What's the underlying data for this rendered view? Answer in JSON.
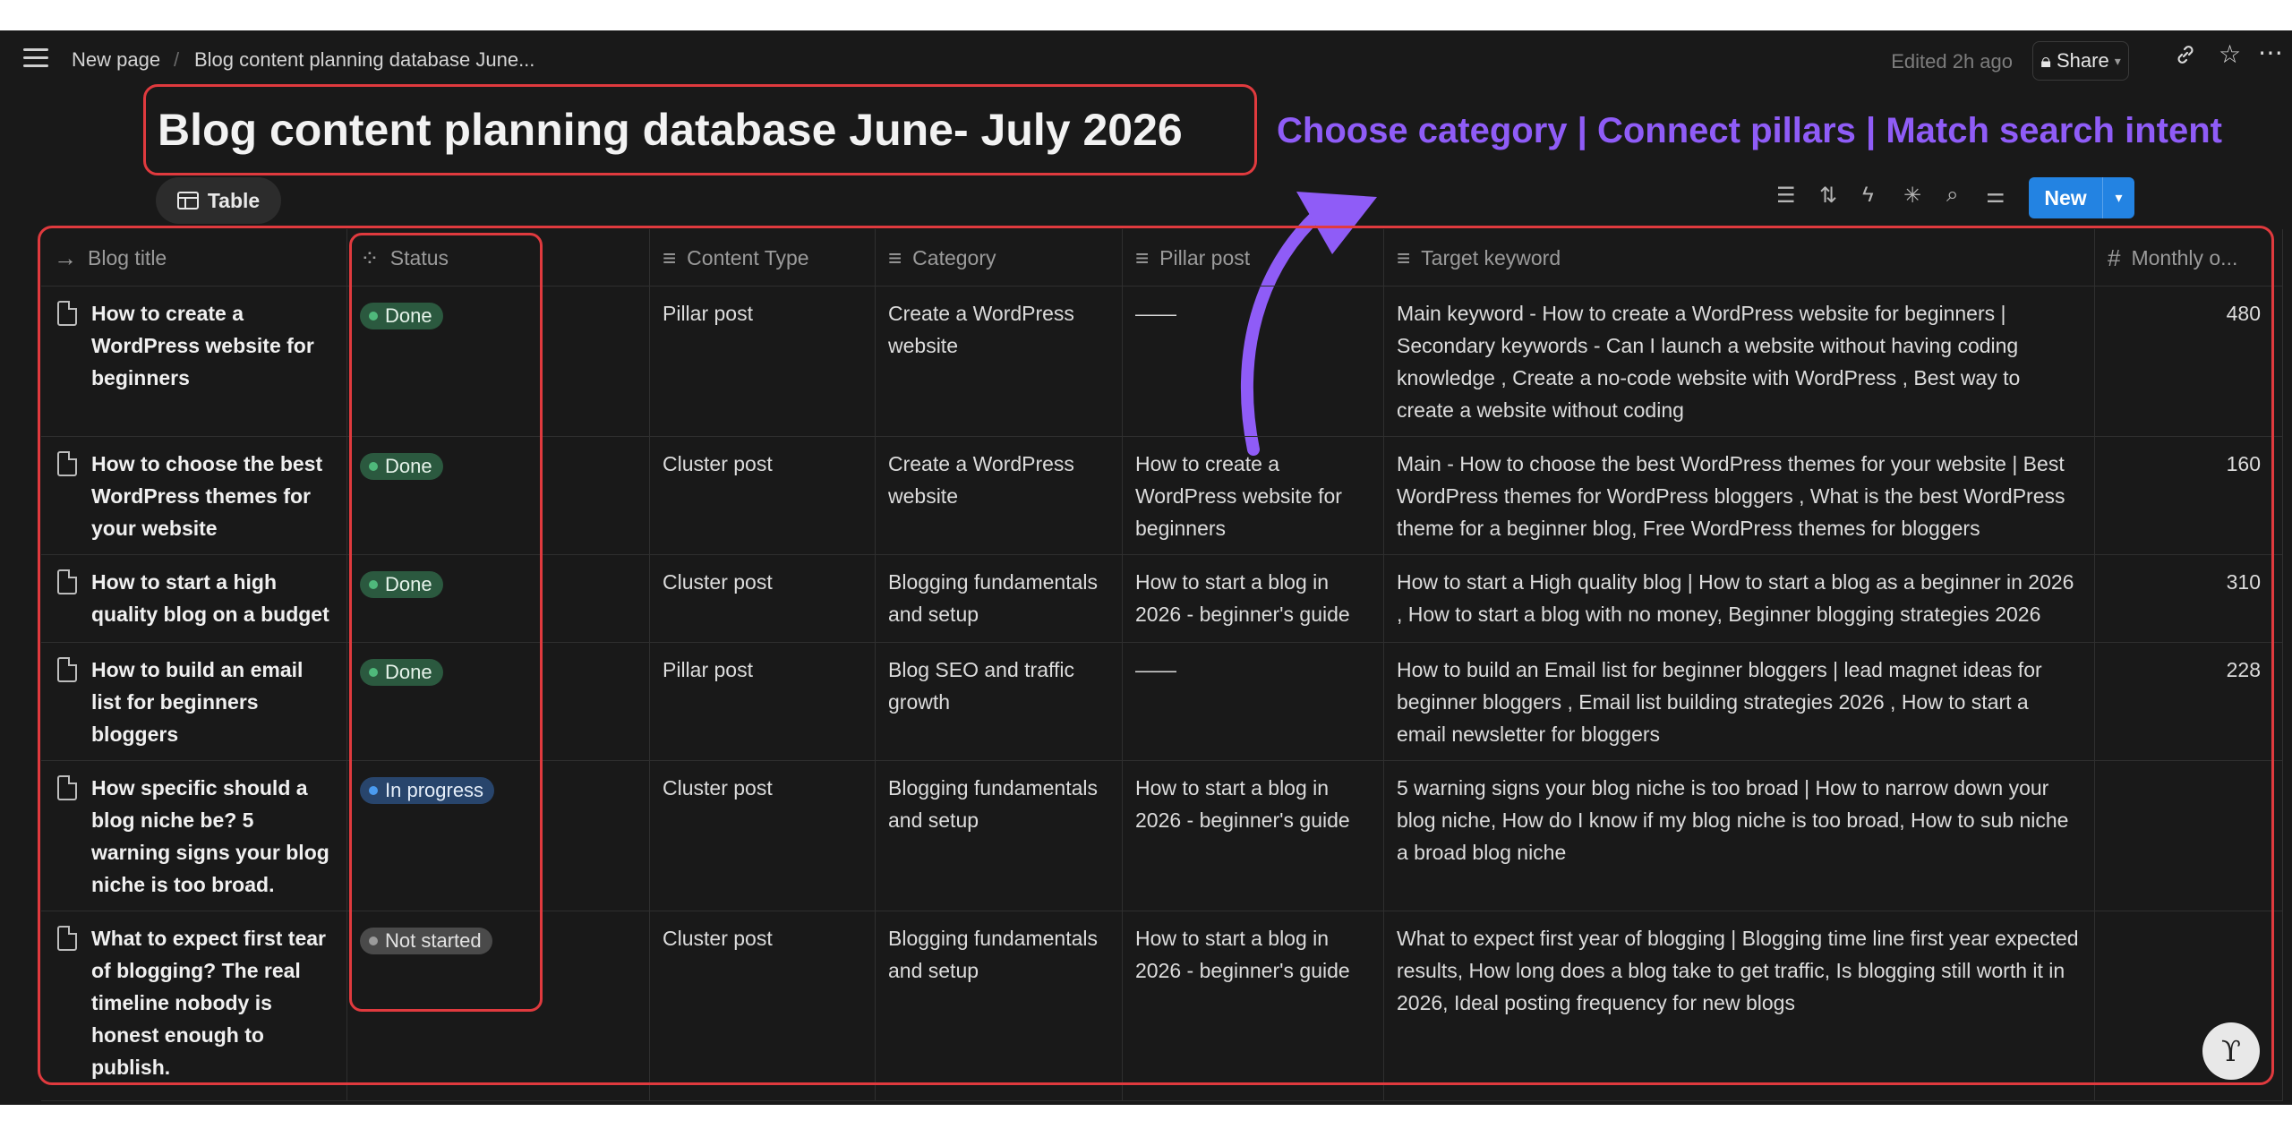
{
  "breadcrumb": {
    "items": [
      "New page",
      "Blog content planning database June..."
    ],
    "separator": "/"
  },
  "header": {
    "edited": "Edited 2h ago",
    "share_label": "Share"
  },
  "page": {
    "title": "Blog content planning database June- July 2026",
    "tagline": "Choose category | Connect pillars | Match search intent"
  },
  "view": {
    "tab_label": "Table"
  },
  "toolbar": {
    "new_label": "New"
  },
  "table": {
    "columns": [
      {
        "label": "Blog title",
        "icon": "arrow-right-icon"
      },
      {
        "label": "Status",
        "icon": "status-icon"
      },
      {
        "label": "Content Type",
        "icon": "text-lines-icon"
      },
      {
        "label": "Category",
        "icon": "text-lines-icon"
      },
      {
        "label": "Pillar post",
        "icon": "text-lines-icon"
      },
      {
        "label": "Target keyword",
        "icon": "text-lines-icon"
      },
      {
        "label": "Monthly o...",
        "icon": "hash-icon"
      }
    ],
    "rows": [
      {
        "title": "How to create a WordPress website for beginners",
        "status": "Done",
        "content_type": "Pillar post",
        "category": "Create a WordPress website",
        "pillar": "——",
        "keyword": "Main keyword - How to create a WordPress website for beginners | Secondary keywords - Can I launch a website without having coding knowledge , Create a no-code website with WordPress , Best way to create a website without coding",
        "monthly": "480"
      },
      {
        "title": "How to choose the best WordPress themes for your website",
        "status": "Done",
        "content_type": "Cluster post",
        "category": "Create a WordPress website",
        "pillar": "How to create a WordPress website for beginners",
        "keyword": "Main - How to choose the best WordPress themes for your website | Best WordPress themes for WordPress bloggers , What is the best WordPress theme for a beginner blog, Free WordPress themes for bloggers",
        "monthly": "160"
      },
      {
        "title": "How to start a high quality blog on a budget",
        "status": "Done",
        "content_type": "Cluster post",
        "category": "Blogging fundamentals and setup",
        "pillar": "How to start a blog in 2026 - beginner's guide",
        "keyword": "How to start a High quality blog | How to start a blog as a beginner in 2026 , How to start a blog with no money, Beginner blogging strategies 2026",
        "monthly": "310"
      },
      {
        "title": "How to build an email list for beginners bloggers",
        "status": "Done",
        "content_type": "Pillar post",
        "category": "Blog SEO and traffic growth",
        "pillar": "——",
        "keyword": "How to build an Email list for beginner bloggers | lead magnet ideas for beginner bloggers , Email list building strategies 2026 , How to start a email newsletter for bloggers",
        "monthly": "228"
      },
      {
        "title": "How specific should a blog niche be? 5 warning signs your blog niche is too broad.",
        "status": "In progress",
        "content_type": "Cluster post",
        "category": "Blogging fundamentals and setup",
        "pillar": "How to start a blog in 2026 - beginner's guide",
        "keyword": "5 warning signs your blog niche is too broad | How to narrow down your blog niche, How do I know if my blog niche is too broad, How to sub niche a broad blog niche",
        "monthly": ""
      },
      {
        "title": "What to expect first tear of blogging? The real timeline nobody is honest enough to publish.",
        "status": "Not started",
        "content_type": "Cluster post",
        "category": "Blogging fundamentals and setup",
        "pillar": "How to start a blog in 2026 - beginner's guide",
        "keyword": "What to expect first year of blogging | Blogging time line first year expected results, How long does a blog take to get traffic, Is blogging still worth it in 2026,  Ideal posting frequency for new blogs",
        "monthly": ""
      }
    ]
  },
  "colors": {
    "background": "#191919",
    "accent_purple": "#8f5cf7",
    "annotation_red": "#e03a3e",
    "new_button": "#2383e2",
    "status_done": "#2b593f",
    "status_in_progress": "#28456c",
    "status_not_started": "#4a4a4a"
  }
}
